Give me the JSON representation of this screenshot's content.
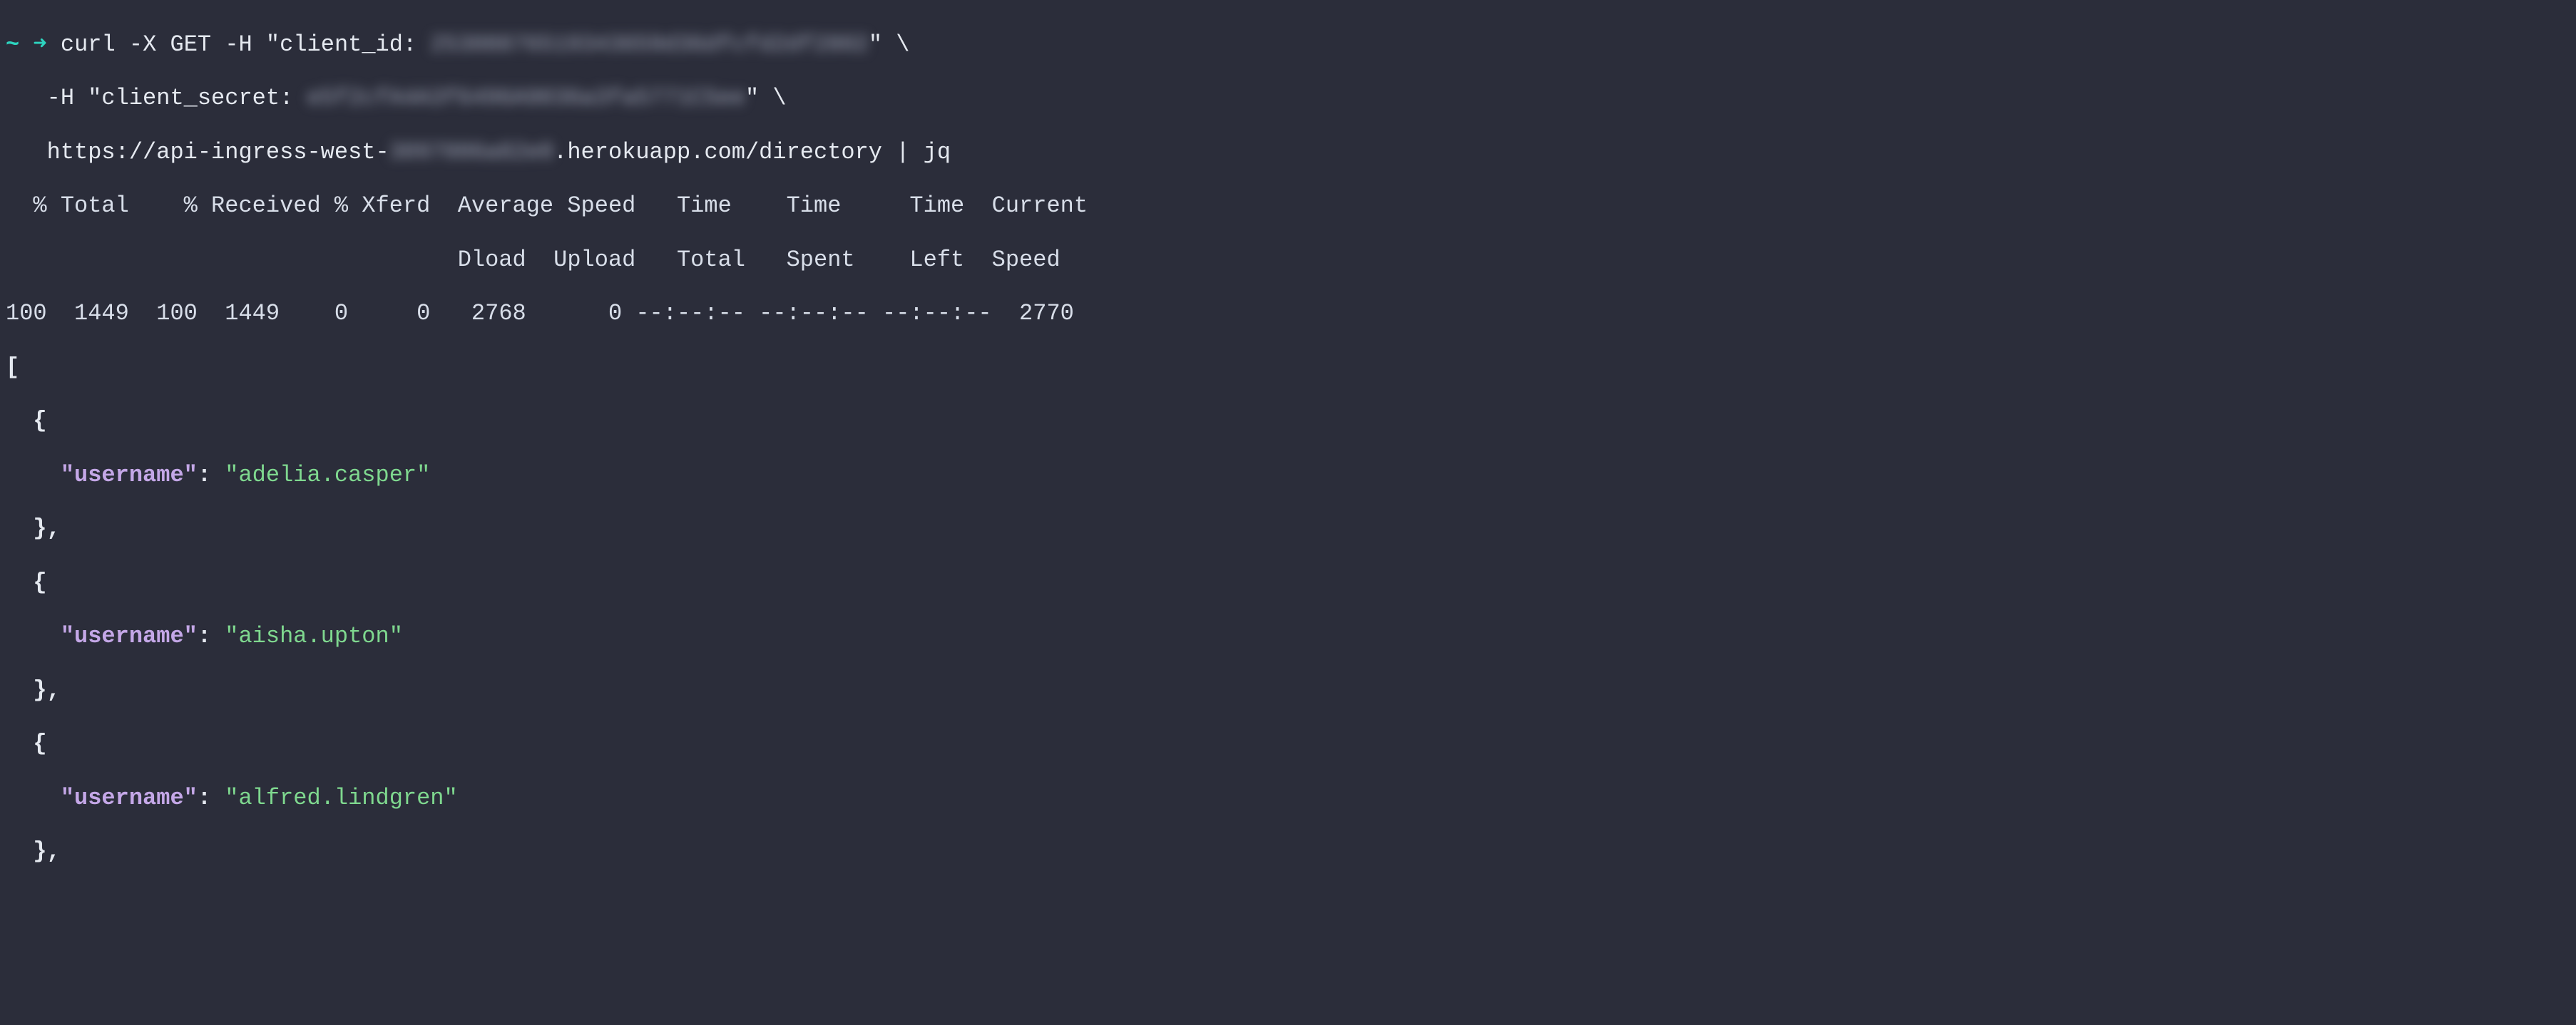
{
  "prompt": {
    "tilde": "~",
    "arrow": "➜"
  },
  "cmd": {
    "l1a": " curl -X GET -H \"client_id: ",
    "l1_redacted": "25308876519343659d36dfcfd2df2802",
    "l1b": "\" \\",
    "l2a": "   -H \"client_secret: ",
    "l2_redacted": "e5f2cfA4A3f6496A9036a3fa5771C5ee",
    "l2b": "\" \\",
    "l3a": "   https://api-ingress-west-",
    "l3_redacted": "3097006a82e0",
    "l3b": ".herokuapp.com/directory | jq"
  },
  "progress": {
    "hdr1": "  % Total    % Received % Xferd  Average Speed   Time    Time     Time  Current",
    "hdr2": "                                 Dload  Upload   Total   Spent    Left  Speed",
    "row": "100  1449  100  1449    0     0   2768      0 --:--:-- --:--:-- --:--:--  2770"
  },
  "json": {
    "open": "[",
    "obj_open": "  {",
    "obj_close_comma": "  },",
    "key_label": "\"username\"",
    "colon_space": ": ",
    "indent": "    ",
    "users": [
      {
        "value": "\"adelia.casper\""
      },
      {
        "value": "\"aisha.upton\""
      },
      {
        "value": "\"alfred.lindgren\""
      }
    ]
  }
}
